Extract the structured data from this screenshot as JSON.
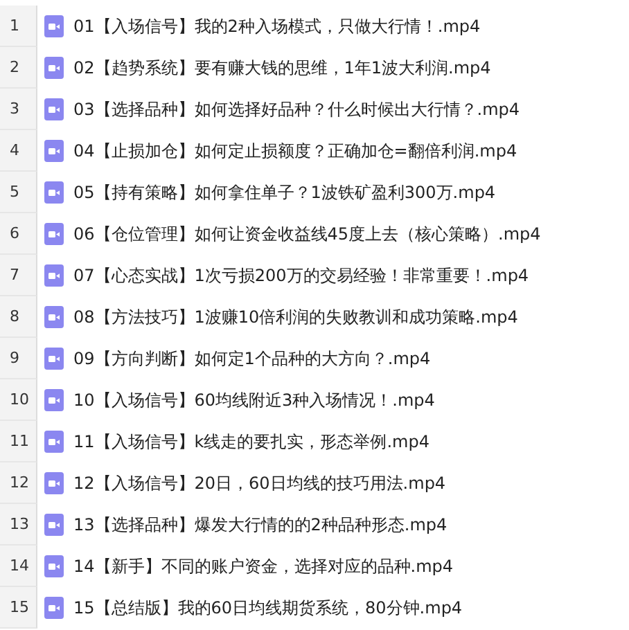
{
  "files": [
    {
      "line": "1",
      "name": "01【入场信号】我的2种入场模式，只做大行情！.mp4"
    },
    {
      "line": "2",
      "name": "02【趋势系统】要有赚大钱的思维，1年1波大利润.mp4"
    },
    {
      "line": "3",
      "name": "03【选择品种】如何选择好品种？什么时候出大行情？.mp4"
    },
    {
      "line": "4",
      "name": "04【止损加仓】如何定止损额度？正确加仓=翻倍利润.mp4"
    },
    {
      "line": "5",
      "name": "05【持有策略】如何拿住单子？1波铁矿盈利300万.mp4"
    },
    {
      "line": "6",
      "name": "06【仓位管理】如何让资金收益线45度上去（核心策略）.mp4"
    },
    {
      "line": "7",
      "name": "07【心态实战】1次亏损200万的交易经验！非常重要！.mp4"
    },
    {
      "line": "8",
      "name": "08【方法技巧】1波赚10倍利润的失败教训和成功策略.mp4"
    },
    {
      "line": "9",
      "name": "09【方向判断】如何定1个品种的大方向？.mp4"
    },
    {
      "line": "10",
      "name": "10【入场信号】60均线附近3种入场情况！.mp4"
    },
    {
      "line": "11",
      "name": "11【入场信号】k线走的要扎实，形态举例.mp4"
    },
    {
      "line": "12",
      "name": "12【入场信号】20日，60日均线的技巧用法.mp4"
    },
    {
      "line": "13",
      "name": "13【选择品种】爆发大行情的的2种品种形态.mp4"
    },
    {
      "line": "14",
      "name": "14【新手】不同的账户资金，选择对应的品种.mp4"
    },
    {
      "line": "15",
      "name": "15【总结版】我的60日均线期货系统，80分钟.mp4"
    }
  ]
}
